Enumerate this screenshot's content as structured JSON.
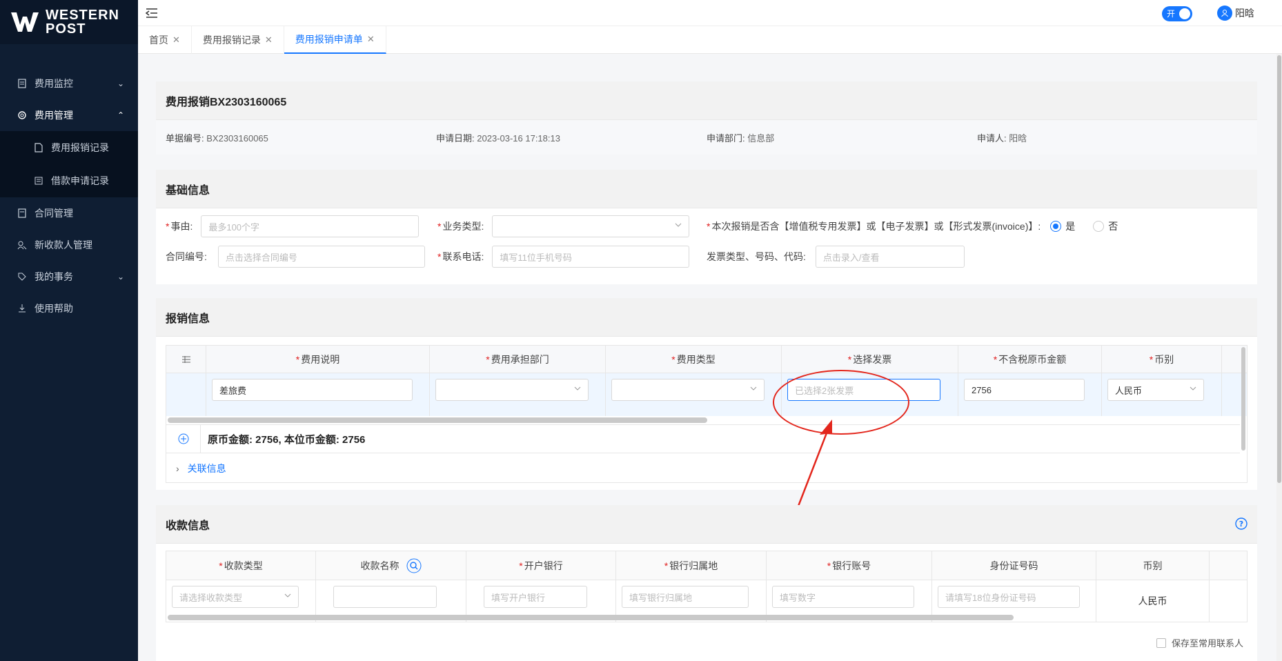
{
  "app": {
    "logo_line1": "WESTERN",
    "logo_line2": "POST",
    "brand_color": "#0f1e33",
    "accent": "#1677ff"
  },
  "sidebar": {
    "items": [
      {
        "label": "费用监控",
        "icon": "document-icon"
      },
      {
        "label": "费用管理",
        "icon": "gear-icon"
      },
      {
        "label": "费用报销记录",
        "icon": "file-icon"
      },
      {
        "label": "借款申请记录",
        "icon": "list-icon"
      },
      {
        "label": "合同管理",
        "icon": "document-icon"
      },
      {
        "label": "新收款人管理",
        "icon": "users-icon"
      },
      {
        "label": "我的事务",
        "icon": "tag-icon"
      },
      {
        "label": "使用帮助",
        "icon": "download-icon"
      }
    ]
  },
  "header": {
    "toggle_label": "开",
    "user_name": "阳晗"
  },
  "tabs": [
    {
      "label": "首页"
    },
    {
      "label": "费用报销记录"
    },
    {
      "label": "费用报销申请单"
    }
  ],
  "doc": {
    "title": "费用报销BX2303160065",
    "meta": [
      {
        "label": "单据编号:",
        "value": "BX2303160065"
      },
      {
        "label": "申请日期:",
        "value": "2023-03-16 17:18:13"
      },
      {
        "label": "申请部门:",
        "value": "信息部"
      },
      {
        "label": "申请人:",
        "value": "阳晗"
      }
    ]
  },
  "basic": {
    "title": "基础信息",
    "reason_label": "事由:",
    "reason_placeholder": "最多100个字",
    "biz_type_label": "业务类型:",
    "invoice_q_label": "本次报销是否含【增值税专用发票】或【电子发票】或【形式发票(invoice)】:",
    "yes": "是",
    "no": "否",
    "contract_label": "合同编号:",
    "contract_placeholder": "点击选择合同编号",
    "phone_label": "联系电话:",
    "phone_placeholder": "填写11位手机号码",
    "invoice_type_label": "发票类型、号码、代码:",
    "invoice_type_placeholder": "点击录入/查看"
  },
  "reimb": {
    "title": "报销信息",
    "columns": [
      "费用说明",
      "费用承担部门",
      "费用类型",
      "选择发票",
      "不含税原币金额",
      "币别"
    ],
    "row": {
      "desc": "差旅费",
      "invoice": "已选择2张发票",
      "amount": "2756",
      "currency": "人民币"
    },
    "summary": "原币金额: 2756, 本位币金额: 2756",
    "related": "关联信息"
  },
  "payee": {
    "title": "收款信息",
    "columns": [
      "收款类型",
      "收款名称",
      "开户银行",
      "银行归属地",
      "银行账号",
      "身份证号码",
      "币别"
    ],
    "type_placeholder": "请选择收款类型",
    "bank_placeholder": "填写开户银行",
    "region_placeholder": "填写银行归属地",
    "account_placeholder": "填写数字",
    "id_placeholder": "请填写18位身份证号码",
    "currency": "人民币",
    "save_contact": "保存至常用联系人"
  }
}
